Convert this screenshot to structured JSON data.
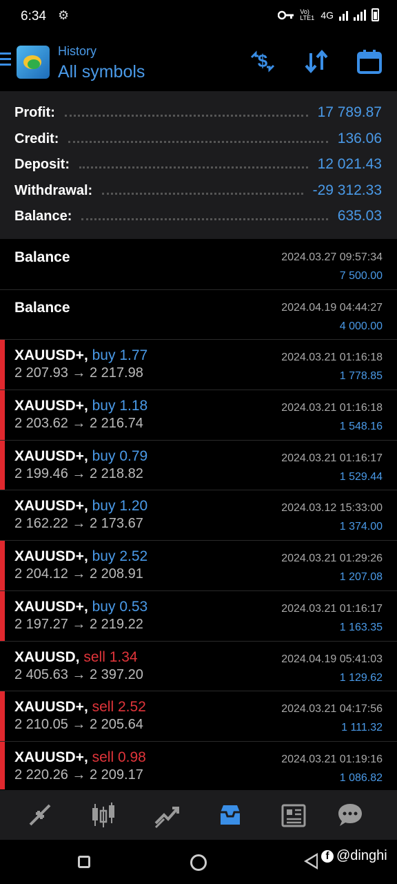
{
  "status_bar": {
    "time": "6:34",
    "network_label": "4G",
    "volte_label": "Vo) LTE1"
  },
  "header": {
    "subtitle": "History",
    "title": "All symbols"
  },
  "summary": [
    {
      "label": "Profit:",
      "value": "17 789.87"
    },
    {
      "label": "Credit:",
      "value": "136.06"
    },
    {
      "label": "Deposit:",
      "value": "12 021.43"
    },
    {
      "label": "Withdrawal:",
      "value": "-29 312.33"
    },
    {
      "label": "Balance:",
      "value": "635.03"
    }
  ],
  "balance_items": [
    {
      "title": "Balance",
      "date": "2024.03.27 09:57:34",
      "amount": "7 500.00"
    },
    {
      "title": "Balance",
      "date": "2024.04.19 04:44:27",
      "amount": "4 000.00"
    }
  ],
  "trades": [
    {
      "symbol": "XAUUSD+,",
      "direction": "buy 1.77",
      "type": "buy",
      "prices": "2 207.93 → 2 217.98",
      "date": "2024.03.21 01:16:18",
      "amount": "1 778.85",
      "accent": true
    },
    {
      "symbol": "XAUUSD+,",
      "direction": "buy 1.18",
      "type": "buy",
      "prices": "2 203.62 → 2 216.74",
      "date": "2024.03.21 01:16:18",
      "amount": "1 548.16",
      "accent": true
    },
    {
      "symbol": "XAUUSD+,",
      "direction": "buy 0.79",
      "type": "buy",
      "prices": "2 199.46 → 2 218.82",
      "date": "2024.03.21 01:16:17",
      "amount": "1 529.44",
      "accent": true
    },
    {
      "symbol": "XAUUSD+,",
      "direction": "buy 1.20",
      "type": "buy",
      "prices": "2 162.22 → 2 173.67",
      "date": "2024.03.12 15:33:00",
      "amount": "1 374.00",
      "accent": false
    },
    {
      "symbol": "XAUUSD+,",
      "direction": "buy 2.52",
      "type": "buy",
      "prices": "2 204.12 → 2 208.91",
      "date": "2024.03.21 01:29:26",
      "amount": "1 207.08",
      "accent": true
    },
    {
      "symbol": "XAUUSD+,",
      "direction": "buy 0.53",
      "type": "buy",
      "prices": "2 197.27 → 2 219.22",
      "date": "2024.03.21 01:16:17",
      "amount": "1 163.35",
      "accent": true
    },
    {
      "symbol": "XAUUSD,",
      "direction": "sell 1.34",
      "type": "sell",
      "prices": "2 405.63 → 2 397.20",
      "date": "2024.04.19 05:41:03",
      "amount": "1 129.62",
      "accent": false
    },
    {
      "symbol": "XAUUSD+,",
      "direction": "sell 2.52",
      "type": "sell",
      "prices": "2 210.05 → 2 205.64",
      "date": "2024.03.21 04:17:56",
      "amount": "1 111.32",
      "accent": true
    },
    {
      "symbol": "XAUUSD+,",
      "direction": "sell 0.98",
      "type": "sell",
      "prices": "2 220.26 → 2 209.17",
      "date": "2024.03.21 01:19:16",
      "amount": "1 086.82",
      "accent": true
    }
  ],
  "bottom_nav": {
    "icons": [
      "quotes-icon",
      "chart-icon",
      "trade-icon",
      "history-icon",
      "news-icon",
      "chat-icon"
    ],
    "active": "history-icon"
  },
  "watermark": {
    "text": "@dinghi"
  },
  "colors": {
    "accent_blue": "#4a9ae8",
    "sell_red": "#e0343a",
    "panel": "#1c1c1e",
    "active_nav": "#3a8ee6"
  }
}
